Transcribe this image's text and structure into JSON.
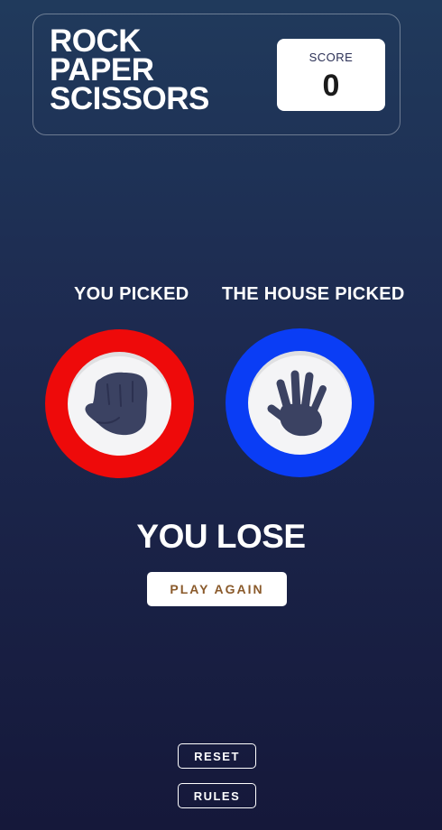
{
  "header": {
    "title_lines": [
      "ROCK",
      "PAPER",
      "SCISSORS"
    ],
    "score_label": "SCORE",
    "score_value": "0"
  },
  "game": {
    "player_label": "YOU PICKED",
    "house_label": "THE HOUSE PICKED",
    "player_pick": "rock",
    "house_pick": "paper",
    "player_pick_icon": "rock-fist-icon",
    "house_pick_icon": "paper-hand-icon",
    "result_text": "YOU LOSE",
    "play_again_label": "PLAY AGAIN"
  },
  "footer": {
    "reset_label": "RESET",
    "rules_label": "RULES"
  },
  "colors": {
    "rock_ring": "#ee0a0a",
    "paper_ring": "#0a3df5",
    "icon_fill": "#3b4262",
    "play_again_text": "#8a5a2b",
    "background_top": "#203a5c",
    "background_bottom": "#15183a"
  }
}
